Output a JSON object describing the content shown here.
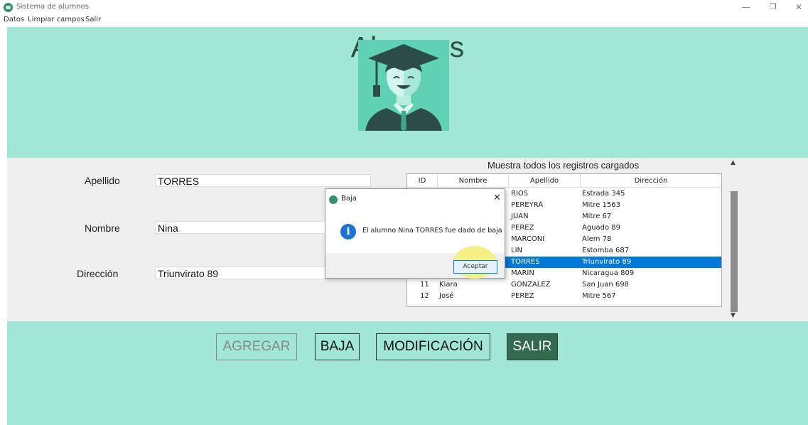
{
  "window": {
    "title": "Sistema de alumnos",
    "minimize_icon": "minimize-icon",
    "restore_icon": "restore-icon",
    "close_icon": "close-icon"
  },
  "menu": {
    "items": [
      "Datos",
      "Limpiar campos",
      "Salir"
    ]
  },
  "header": {
    "title": "Alumnos",
    "logo_icon": "graduate-student-icon"
  },
  "form": {
    "apellido_label": "Apellido",
    "apellido_value": "TORRES",
    "nombre_label": "Nombre",
    "nombre_value": "Nina",
    "direccion_label": "Dirección",
    "direccion_value": "Triunvirato 89"
  },
  "list": {
    "caption": "Muestra todos los registros cargados",
    "columns": [
      "ID",
      "Nombre",
      "Apellido",
      "Dirección"
    ],
    "rows": [
      {
        "id": "",
        "nombre": "",
        "apellido": "RIOS",
        "direccion": "Estrada 345"
      },
      {
        "id": "",
        "nombre": "",
        "apellido": "PEREYRA",
        "direccion": "Mitre 1563"
      },
      {
        "id": "",
        "nombre": "",
        "apellido": "JUAN",
        "direccion": "Mitre 67"
      },
      {
        "id": "",
        "nombre": "",
        "apellido": "PEREZ",
        "direccion": "Aguado 89"
      },
      {
        "id": "",
        "nombre": "",
        "apellido": "MARCONI",
        "direccion": "Alem 78"
      },
      {
        "id": "",
        "nombre": "",
        "apellido": "LIN",
        "direccion": "Estomba 687"
      },
      {
        "id": "",
        "nombre": "",
        "apellido": "TORRES",
        "direccion": "Triunvirato 89"
      },
      {
        "id": "",
        "nombre": "",
        "apellido": "MARIN",
        "direccion": "Nicaragua 809"
      },
      {
        "id": "11",
        "nombre": "Kiara",
        "apellido": "GONZALEZ",
        "direccion": "San Juan 698"
      },
      {
        "id": "12",
        "nombre": "José",
        "apellido": "PEREZ",
        "direccion": "Mitre 567"
      }
    ],
    "selected_index": 6
  },
  "buttons": {
    "agregar": "AGREGAR",
    "baja": "BAJA",
    "modificacion": "MODIFICACIÓN",
    "salir": "SALIR"
  },
  "dialog": {
    "title": "Baja",
    "message": "El alumno Nina TORRES fue dado de baja",
    "ok_label": "Aceptar",
    "info_icon": "info-icon"
  },
  "colors": {
    "mint": "#a0e8d5",
    "dark_green": "#33694f",
    "selection_blue": "#0078d7"
  }
}
